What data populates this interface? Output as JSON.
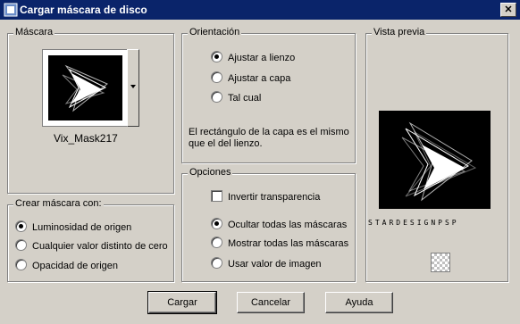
{
  "window": {
    "title": "Cargar máscara de disco",
    "close_label": "✕"
  },
  "mask_group": {
    "legend": "Máscara",
    "mask_name": "Vix_Mask217"
  },
  "orientation_group": {
    "legend": "Orientación",
    "options": [
      "Ajustar a lienzo",
      "Ajustar a capa",
      "Tal cual"
    ],
    "selected": 0,
    "description": "El rectángulo de la capa es el mismo que el del lienzo."
  },
  "preview_group": {
    "legend": "Vista previa",
    "watermark": "STARDESIGNPSP"
  },
  "create_group": {
    "legend": "Crear máscara con:",
    "options": [
      "Luminosidad de origen",
      "Cualquier valor distinto de cero",
      "Opacidad de origen"
    ],
    "selected": 0
  },
  "options_group": {
    "legend": "Opciones",
    "invert_label": "Invertir transparencia",
    "invert_checked": false,
    "options": [
      "Ocultar todas las máscaras",
      "Mostrar todas las máscaras",
      "Usar valor de imagen"
    ],
    "selected": 0
  },
  "buttons": {
    "load": "Cargar",
    "cancel": "Cancelar",
    "help": "Ayuda"
  }
}
